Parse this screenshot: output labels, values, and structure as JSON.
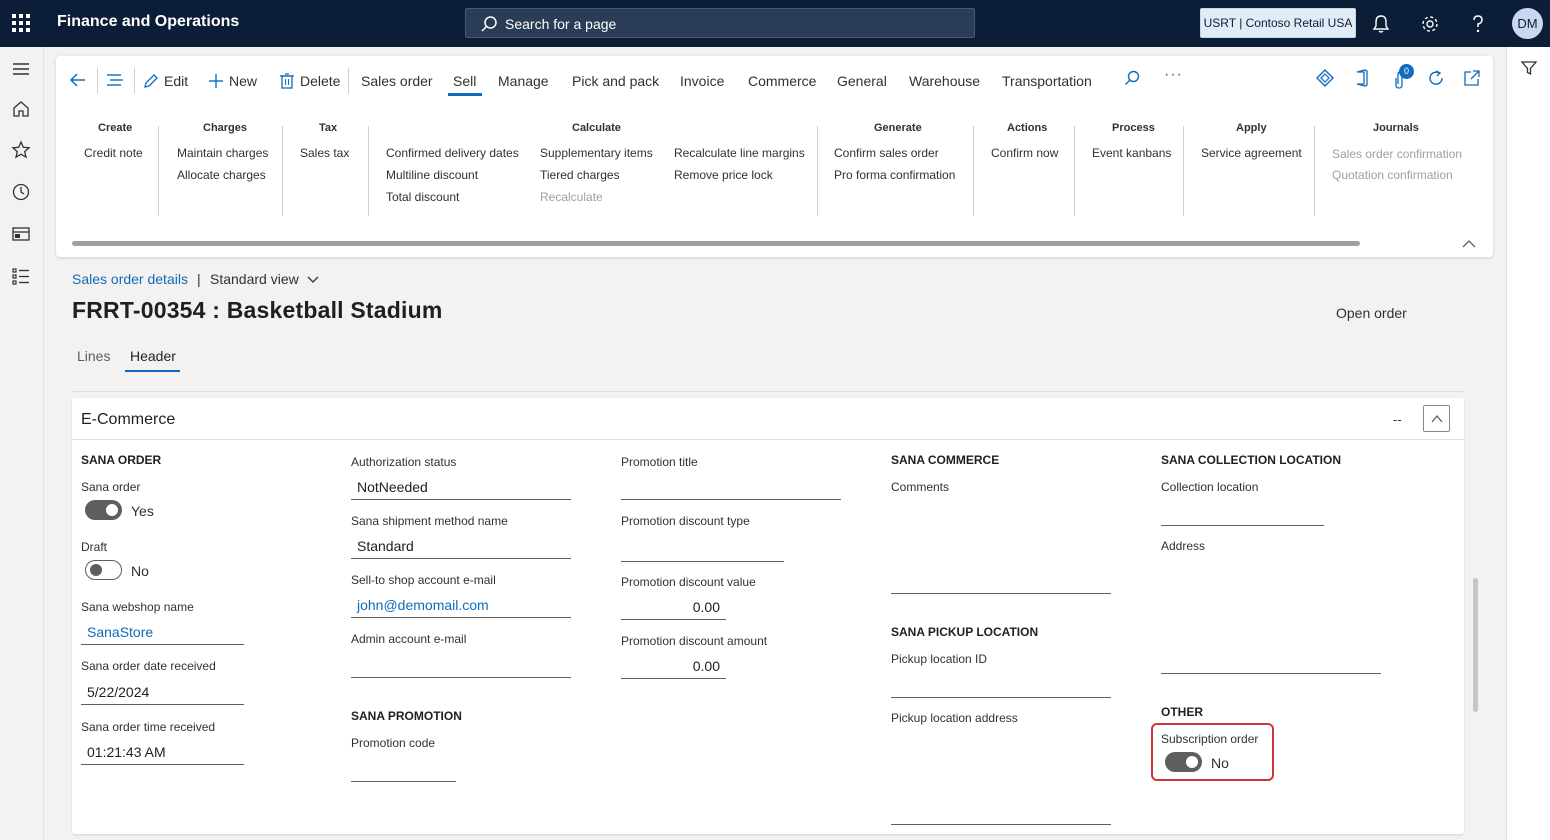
{
  "app": {
    "title": "Finance and Operations",
    "search_placeholder": "Search for a page",
    "company": "USRT | Contoso Retail USA",
    "user_initials": "DM"
  },
  "actionbar": {
    "edit": "Edit",
    "new": "New",
    "delete": "Delete",
    "tabs": [
      "Sales order",
      "Sell",
      "Manage",
      "Pick and pack",
      "Invoice",
      "Commerce",
      "General",
      "Warehouse",
      "Transportation"
    ],
    "active_tab": "Sell",
    "attachment_count": "0"
  },
  "groups": {
    "create": {
      "title": "Create",
      "items": [
        "Credit note"
      ]
    },
    "charges": {
      "title": "Charges",
      "items": [
        "Maintain charges",
        "Allocate charges"
      ]
    },
    "tax": {
      "title": "Tax",
      "items": [
        "Sales tax"
      ]
    },
    "calculate": {
      "title": "Calculate",
      "col1": [
        "Confirmed delivery dates",
        "Multiline discount",
        "Total discount"
      ],
      "col2": [
        "Supplementary items",
        "Tiered charges",
        "Recalculate"
      ],
      "col3": [
        "Recalculate line margins",
        "Remove price lock"
      ]
    },
    "generate": {
      "title": "Generate",
      "items": [
        "Confirm sales order",
        "Pro forma confirmation"
      ]
    },
    "actions": {
      "title": "Actions",
      "items": [
        "Confirm now"
      ]
    },
    "process": {
      "title": "Process",
      "items": [
        "Event kanbans"
      ]
    },
    "apply": {
      "title": "Apply",
      "items": [
        "Service agreement"
      ]
    },
    "journals": {
      "title": "Journals",
      "items": [
        "Sales order confirmation",
        "Quotation confirmation"
      ]
    }
  },
  "page": {
    "breadcrumb": "Sales order details",
    "separator": "|",
    "view": "Standard view",
    "title": "FRRT-00354 : Basketball Stadium",
    "status": "Open order",
    "tabs": [
      "Lines",
      "Header"
    ]
  },
  "fasttab": {
    "title": "E-Commerce",
    "summary": "--"
  },
  "sana_order": {
    "heading": "SANA ORDER",
    "sana_order_label": "Sana order",
    "sana_order_value": "Yes",
    "draft_label": "Draft",
    "draft_value": "No",
    "webshop_label": "Sana webshop name",
    "webshop_value": "SanaStore",
    "date_label": "Sana order date received",
    "date_value": "5/22/2024",
    "time_label": "Sana order time received",
    "time_value": "01:21:43 AM"
  },
  "col2": {
    "auth_label": "Authorization status",
    "auth_value": "NotNeeded",
    "shipment_label": "Sana shipment method name",
    "shipment_value": "Standard",
    "email_label": "Sell-to shop account e-mail",
    "email_value": "john@demomail.com",
    "admin_label": "Admin account e-mail",
    "admin_value": "",
    "promo_heading": "SANA PROMOTION",
    "promo_code_label": "Promotion code",
    "promo_code_value": ""
  },
  "col3": {
    "promo_title_label": "Promotion title",
    "promo_title_value": "",
    "promo_type_label": "Promotion discount type",
    "promo_type_value": "",
    "promo_value_label": "Promotion discount value",
    "promo_value_value": "0.00",
    "promo_amount_label": "Promotion discount amount",
    "promo_amount_value": "0.00"
  },
  "col4": {
    "heading": "SANA COMMERCE",
    "comments_label": "Comments",
    "pickup_heading": "SANA PICKUP LOCATION",
    "pickup_id_label": "Pickup location ID",
    "pickup_address_label": "Pickup location address"
  },
  "col5": {
    "heading": "SANA COLLECTION LOCATION",
    "collection_label": "Collection location",
    "address_label": "Address",
    "other_heading": "OTHER",
    "subscription_label": "Subscription order",
    "subscription_value": "No"
  }
}
